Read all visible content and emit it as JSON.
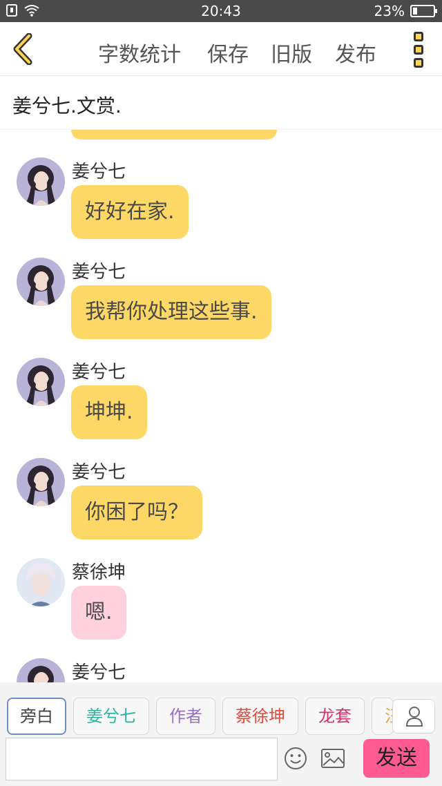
{
  "status_bar": {
    "time": "20:43",
    "battery_percent": "23%",
    "battery_level": 0.23
  },
  "toolbar": {
    "menu": [
      "字数统计",
      "保存",
      "旧版",
      "发布"
    ]
  },
  "title": "姜兮七.文赏.",
  "messages": [
    {
      "sender": "姜兮七",
      "text": "好好在家.",
      "style": "yellow",
      "avatar": "girl"
    },
    {
      "sender": "姜兮七",
      "text": "我帮你处理这些事.",
      "style": "yellow",
      "avatar": "girl"
    },
    {
      "sender": "姜兮七",
      "text": "坤坤.",
      "style": "yellow",
      "avatar": "girl"
    },
    {
      "sender": "姜兮七",
      "text": "你困了吗？",
      "style": "yellow",
      "avatar": "girl"
    },
    {
      "sender": "蔡徐坤",
      "text": "嗯.",
      "style": "pink",
      "avatar": "boy"
    },
    {
      "sender": "姜兮七",
      "text": "",
      "style": "yellow",
      "avatar": "girl"
    }
  ],
  "roles": [
    {
      "label": "旁白",
      "color": "#555555",
      "active": true
    },
    {
      "label": "姜兮七",
      "color": "#2bb5a0",
      "active": false
    },
    {
      "label": "作者",
      "color": "#9a6fc4",
      "active": false
    },
    {
      "label": "蔡徐坤",
      "color": "#e04b3a",
      "active": false
    },
    {
      "label": "龙套",
      "color": "#d6336c",
      "active": false
    },
    {
      "label": "汪",
      "color": "#f0a030",
      "active": false
    }
  ],
  "input": {
    "value": "",
    "send_label": "发送"
  },
  "colors": {
    "accent_yellow": "#fdd866",
    "accent_pink": "#ffd0dd",
    "send_button": "#ff5b92",
    "status_bar": "#4a4a4a"
  }
}
